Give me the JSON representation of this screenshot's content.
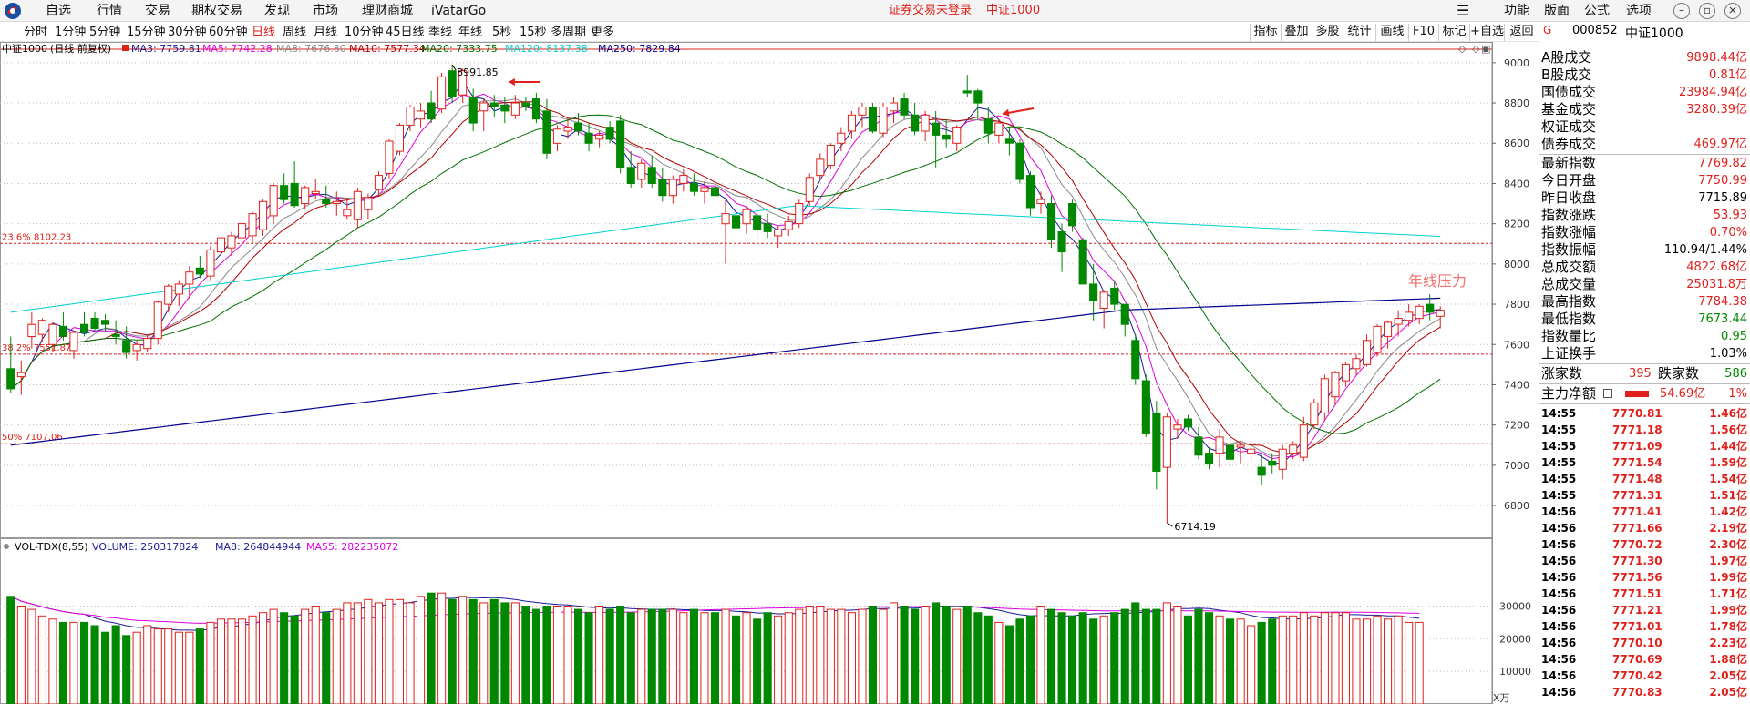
{
  "menubar": {
    "items": [
      "自选",
      "行情",
      "交易",
      "期权交易",
      "发现",
      "市场",
      "理财商城",
      "iVatarGo"
    ],
    "status_login": "证券交易未登录",
    "status_index": "中证1000",
    "right_items": [
      "功能",
      "版面",
      "公式",
      "选项"
    ],
    "window_buttons": [
      "minimize-icon",
      "restore-icon",
      "close-icon"
    ]
  },
  "periodbar": {
    "items": [
      "分时",
      "1分钟",
      "5分钟",
      "15分钟",
      "30分钟",
      "60分钟",
      "日线",
      "周线",
      "月线",
      "10分钟",
      "45日线",
      "季线",
      "年线",
      "5秒",
      "15秒",
      "多周期",
      "更多"
    ],
    "active": "日线",
    "tools": [
      "指标",
      "叠加",
      "多股",
      "统计",
      "画线",
      "F10",
      "标记",
      "+自选",
      "返回"
    ]
  },
  "indicators": {
    "title": "中证1000",
    "mode": "(日线 前复权)",
    "ma": [
      {
        "label": "MA3: 7759.81",
        "color": "#1a1a9a"
      },
      {
        "label": "MA5: 7742.28",
        "color": "#e000e0"
      },
      {
        "label": "MA8: 7676.80",
        "color": "#888888"
      },
      {
        "label": "MA10: 7577.34",
        "color": "#b00000"
      },
      {
        "label": "MA20: 7333.75",
        "color": "#007000"
      },
      {
        "label": "MA120: 8137.38",
        "color": "#00d0d0"
      },
      {
        "label": "MA250: 7829.84",
        "color": "#000090"
      }
    ]
  },
  "annotations": {
    "high_label": "8991.85",
    "low_label": "6714.19",
    "fib_236": "23.6% 8102.23",
    "fib_382": "38.2% 7551.87",
    "fib_50": "50% 7107.06",
    "resistance": "年线压力"
  },
  "volume_panel": {
    "label_name": "VOL-TDX(8,55)",
    "volume": "VOLUME: 250317824",
    "ma8": "MA8: 264844944",
    "ma55": "MA55: 282235072",
    "unit": "X万"
  },
  "chart_data": {
    "type": "candlestick",
    "price_axis": {
      "ticks": [
        6800,
        7000,
        7200,
        7400,
        7600,
        7800,
        8000,
        8200,
        8400,
        8600,
        8800,
        9000
      ],
      "range": [
        6660,
        9040
      ]
    },
    "volume_axis": {
      "ticks": [
        10000,
        20000,
        30000
      ],
      "range": [
        0,
        36000
      ]
    },
    "fib_levels": [
      8102.23,
      7551.87,
      7107.06
    ],
    "candles": [
      [
        7480,
        7640,
        7360,
        7380
      ],
      [
        7440,
        7520,
        7350,
        7460
      ],
      [
        7640,
        7760,
        7580,
        7700
      ],
      [
        7650,
        7730,
        7610,
        7720
      ],
      [
        7600,
        7710,
        7560,
        7700
      ],
      [
        7690,
        7760,
        7620,
        7640
      ],
      [
        7570,
        7670,
        7530,
        7660
      ],
      [
        7700,
        7760,
        7640,
        7660
      ],
      [
        7730,
        7760,
        7670,
        7680
      ],
      [
        7720,
        7750,
        7660,
        7700
      ],
      [
        7650,
        7720,
        7600,
        7640
      ],
      [
        7620,
        7690,
        7530,
        7560
      ],
      [
        7570,
        7620,
        7520,
        7600
      ],
      [
        7580,
        7650,
        7560,
        7630
      ],
      [
        7630,
        7820,
        7600,
        7810
      ],
      [
        7800,
        7900,
        7760,
        7890
      ],
      [
        7850,
        7920,
        7790,
        7900
      ],
      [
        7900,
        7990,
        7830,
        7960
      ],
      [
        7980,
        8040,
        7930,
        7950
      ],
      [
        7940,
        8090,
        7920,
        8070
      ],
      [
        8060,
        8140,
        8040,
        8130
      ],
      [
        8080,
        8160,
        8040,
        8140
      ],
      [
        8130,
        8220,
        8090,
        8200
      ],
      [
        8140,
        8260,
        8100,
        8250
      ],
      [
        8170,
        8320,
        8140,
        8310
      ],
      [
        8240,
        8400,
        8200,
        8390
      ],
      [
        8390,
        8450,
        8300,
        8320
      ],
      [
        8400,
        8510,
        8280,
        8290
      ],
      [
        8300,
        8390,
        8270,
        8380
      ],
      [
        8350,
        8420,
        8320,
        8360
      ],
      [
        8320,
        8390,
        8280,
        8300
      ],
      [
        8300,
        8360,
        8240,
        8310
      ],
      [
        8240,
        8330,
        8220,
        8270
      ],
      [
        8220,
        8380,
        8180,
        8360
      ],
      [
        8270,
        8350,
        8220,
        8330
      ],
      [
        8370,
        8460,
        8340,
        8440
      ],
      [
        8450,
        8620,
        8420,
        8610
      ],
      [
        8560,
        8700,
        8540,
        8690
      ],
      [
        8690,
        8790,
        8660,
        8780
      ],
      [
        8720,
        8800,
        8680,
        8760
      ],
      [
        8800,
        8860,
        8700,
        8720
      ],
      [
        8770,
        8950,
        8750,
        8930
      ],
      [
        8960,
        8990,
        8800,
        8830
      ],
      [
        8840,
        8970,
        8800,
        8960
      ],
      [
        8830,
        8870,
        8660,
        8700
      ],
      [
        8760,
        8820,
        8660,
        8800
      ],
      [
        8800,
        8840,
        8730,
        8780
      ],
      [
        8790,
        8830,
        8700,
        8760
      ],
      [
        8740,
        8840,
        8720,
        8800
      ],
      [
        8800,
        8830,
        8760,
        8780
      ],
      [
        8820,
        8850,
        8700,
        8720
      ],
      [
        8760,
        8820,
        8520,
        8550
      ],
      [
        8600,
        8690,
        8560,
        8670
      ],
      [
        8660,
        8730,
        8620,
        8680
      ],
      [
        8700,
        8750,
        8640,
        8660
      ],
      [
        8650,
        8700,
        8560,
        8600
      ],
      [
        8620,
        8660,
        8580,
        8640
      ],
      [
        8680,
        8710,
        8600,
        8620
      ],
      [
        8710,
        8740,
        8450,
        8480
      ],
      [
        8480,
        8560,
        8380,
        8400
      ],
      [
        8420,
        8520,
        8380,
        8500
      ],
      [
        8480,
        8540,
        8380,
        8400
      ],
      [
        8420,
        8480,
        8310,
        8340
      ],
      [
        8340,
        8440,
        8300,
        8420
      ],
      [
        8400,
        8470,
        8360,
        8440
      ],
      [
        8400,
        8450,
        8340,
        8360
      ],
      [
        8360,
        8410,
        8300,
        8380
      ],
      [
        8380,
        8420,
        8320,
        8340
      ],
      [
        8200,
        8330,
        8000,
        8250
      ],
      [
        8240,
        8310,
        8170,
        8180
      ],
      [
        8200,
        8290,
        8150,
        8270
      ],
      [
        8240,
        8300,
        8130,
        8170
      ],
      [
        8200,
        8250,
        8130,
        8160
      ],
      [
        8140,
        8190,
        8080,
        8170
      ],
      [
        8170,
        8240,
        8140,
        8210
      ],
      [
        8200,
        8320,
        8180,
        8300
      ],
      [
        8310,
        8450,
        8290,
        8430
      ],
      [
        8440,
        8550,
        8420,
        8520
      ],
      [
        8490,
        8600,
        8470,
        8590
      ],
      [
        8600,
        8680,
        8560,
        8650
      ],
      [
        8660,
        8760,
        8620,
        8740
      ],
      [
        8740,
        8800,
        8680,
        8780
      ],
      [
        8780,
        8800,
        8650,
        8660
      ],
      [
        8650,
        8800,
        8630,
        8780
      ],
      [
        8760,
        8830,
        8700,
        8800
      ],
      [
        8820,
        8850,
        8720,
        8740
      ],
      [
        8740,
        8800,
        8640,
        8660
      ],
      [
        8660,
        8760,
        8610,
        8740
      ],
      [
        8700,
        8760,
        8480,
        8640
      ],
      [
        8640,
        8720,
        8580,
        8620
      ],
      [
        8600,
        8690,
        8560,
        8680
      ],
      [
        8860,
        8940,
        8830,
        8850
      ],
      [
        8860,
        8870,
        8720,
        8800
      ],
      [
        8720,
        8780,
        8600,
        8650
      ],
      [
        8640,
        8720,
        8600,
        8700
      ],
      [
        8620,
        8680,
        8540,
        8600
      ],
      [
        8600,
        8620,
        8400,
        8420
      ],
      [
        8440,
        8460,
        8240,
        8280
      ],
      [
        8300,
        8360,
        8250,
        8320
      ],
      [
        8300,
        8340,
        8080,
        8120
      ],
      [
        8160,
        8200,
        7960,
        8060
      ],
      [
        8300,
        8320,
        8160,
        8190
      ],
      [
        8120,
        8130,
        7900,
        7900
      ],
      [
        7900,
        8000,
        7720,
        7820
      ],
      [
        7780,
        7870,
        7680,
        7860
      ],
      [
        7880,
        7920,
        7770,
        7800
      ],
      [
        7800,
        7800,
        7640,
        7700
      ],
      [
        7620,
        7650,
        7400,
        7430
      ],
      [
        7420,
        7450,
        7140,
        7160
      ],
      [
        7260,
        7320,
        6880,
        6970
      ],
      [
        6990,
        7260,
        6714,
        7240
      ],
      [
        7180,
        7230,
        7130,
        7200
      ],
      [
        7230,
        7250,
        7170,
        7190
      ],
      [
        7140,
        7190,
        7030,
        7050
      ],
      [
        7060,
        7090,
        6980,
        7010
      ],
      [
        7060,
        7180,
        6990,
        7140
      ],
      [
        7100,
        7140,
        6990,
        7030
      ],
      [
        7090,
        7120,
        7010,
        7100
      ],
      [
        7060,
        7120,
        7020,
        7080
      ],
      [
        6990,
        7060,
        6900,
        6950
      ],
      [
        7020,
        7060,
        6960,
        7000
      ],
      [
        6980,
        7100,
        6930,
        7080
      ],
      [
        7060,
        7120,
        7030,
        7100
      ],
      [
        7040,
        7240,
        7020,
        7200
      ],
      [
        7200,
        7330,
        7180,
        7310
      ],
      [
        7260,
        7450,
        7220,
        7430
      ],
      [
        7340,
        7470,
        7300,
        7460
      ],
      [
        7420,
        7510,
        7390,
        7500
      ],
      [
        7480,
        7550,
        7450,
        7530
      ],
      [
        7500,
        7650,
        7490,
        7620
      ],
      [
        7560,
        7700,
        7540,
        7690
      ],
      [
        7640,
        7720,
        7580,
        7710
      ],
      [
        7700,
        7770,
        7640,
        7730
      ],
      [
        7720,
        7800,
        7690,
        7760
      ],
      [
        7730,
        7800,
        7700,
        7790
      ],
      [
        7800,
        7850,
        7720,
        7760
      ],
      [
        7740,
        7790,
        7680,
        7770
      ]
    ],
    "volumes": [
      33000,
      30000,
      29000,
      27000,
      26000,
      25000,
      25000,
      25000,
      24000,
      22000,
      24000,
      21000,
      22000,
      24000,
      23000,
      23000,
      22000,
      22000,
      23000,
      25000,
      26000,
      26000,
      26000,
      27000,
      28000,
      29000,
      28000,
      27000,
      29000,
      30000,
      28000,
      29000,
      31000,
      31000,
      32000,
      31000,
      32000,
      32000,
      31000,
      33000,
      34000,
      34000,
      32000,
      33000,
      32000,
      31000,
      32000,
      31000,
      31000,
      30000,
      29000,
      30000,
      30000,
      30000,
      29000,
      28000,
      30000,
      29000,
      30000,
      28000,
      29000,
      29000,
      29000,
      29000,
      28000,
      29000,
      28000,
      28000,
      29000,
      27000,
      28000,
      26000,
      28000,
      27000,
      28000,
      29000,
      30000,
      30000,
      29000,
      29000,
      28000,
      29000,
      30000,
      29000,
      31000,
      30000,
      29000,
      30000,
      31000,
      30000,
      29000,
      30000,
      28000,
      27000,
      25000,
      24000,
      26000,
      27000,
      30000,
      29000,
      28000,
      27000,
      28000,
      26000,
      27000,
      28000,
      29000,
      31000,
      29000,
      29000,
      31000,
      30000,
      27000,
      29000,
      28000,
      27000,
      26000,
      26000,
      24000,
      25000,
      26000,
      27000,
      27000,
      28000,
      27000,
      28000,
      28000,
      28000,
      26000,
      26000,
      27000,
      26000,
      27000,
      25000,
      25000
    ]
  },
  "side": {
    "code": "000852",
    "name": "中证1000",
    "tag": "G",
    "rows1": [
      {
        "label": "A股成交",
        "value": "9898.44亿",
        "color": "#e0201b"
      },
      {
        "label": "B股成交",
        "value": "0.81亿",
        "color": "#e0201b"
      },
      {
        "label": "国债成交",
        "value": "23984.94亿",
        "color": "#e0201b"
      },
      {
        "label": "基金成交",
        "value": "3280.39亿",
        "color": "#e0201b"
      },
      {
        "label": "权证成交",
        "value": "",
        "color": "#e0201b"
      },
      {
        "label": "债券成交",
        "value": "469.97亿",
        "color": "#e0201b"
      }
    ],
    "rows2": [
      {
        "label": "最新指数",
        "value": "7769.82",
        "color": "#e0201b"
      },
      {
        "label": "今日开盘",
        "value": "7750.99",
        "color": "#e0201b"
      },
      {
        "label": "昨日收盘",
        "value": "7715.89",
        "color": "#000000"
      },
      {
        "label": "指数涨跌",
        "value": "53.93",
        "color": "#e0201b"
      },
      {
        "label": "指数涨幅",
        "value": "0.70%",
        "color": "#e0201b"
      },
      {
        "label": "指数振幅",
        "value": "110.94/1.44%",
        "color": "#000000"
      },
      {
        "label": "总成交额",
        "value": "4822.68亿",
        "color": "#e0201b"
      },
      {
        "label": "总成交量",
        "value": "25031.8万",
        "color": "#e0201b"
      },
      {
        "label": "最高指数",
        "value": "7784.38",
        "color": "#e0201b"
      },
      {
        "label": "最低指数",
        "value": "7673.44",
        "color": "#008800"
      },
      {
        "label": "指数量比",
        "value": "0.95",
        "color": "#008800"
      },
      {
        "label": "上证换手",
        "value": "1.03%",
        "color": "#000000"
      }
    ],
    "updown": {
      "up_label": "涨家数",
      "up": "395",
      "down_label": "跌家数",
      "down": "586"
    },
    "mainflow": {
      "label": "主力净额",
      "value": "54.69亿",
      "pct": "1%"
    },
    "ticks": [
      {
        "time": "14:55",
        "price": "7770.81",
        "vol": "1.46亿"
      },
      {
        "time": "14:55",
        "price": "7771.18",
        "vol": "1.56亿"
      },
      {
        "time": "14:55",
        "price": "7771.09",
        "vol": "1.44亿"
      },
      {
        "time": "14:55",
        "price": "7771.54",
        "vol": "1.59亿"
      },
      {
        "time": "14:55",
        "price": "7771.48",
        "vol": "1.54亿"
      },
      {
        "time": "14:55",
        "price": "7771.31",
        "vol": "1.51亿"
      },
      {
        "time": "14:56",
        "price": "7771.41",
        "vol": "1.42亿"
      },
      {
        "time": "14:56",
        "price": "7771.66",
        "vol": "2.19亿"
      },
      {
        "time": "14:56",
        "price": "7770.72",
        "vol": "2.30亿"
      },
      {
        "time": "14:56",
        "price": "7771.30",
        "vol": "1.97亿"
      },
      {
        "time": "14:56",
        "price": "7771.56",
        "vol": "1.99亿"
      },
      {
        "time": "14:56",
        "price": "7771.51",
        "vol": "1.71亿"
      },
      {
        "time": "14:56",
        "price": "7771.21",
        "vol": "1.99亿"
      },
      {
        "time": "14:56",
        "price": "7771.01",
        "vol": "1.78亿"
      },
      {
        "time": "14:56",
        "price": "7770.10",
        "vol": "2.23亿"
      },
      {
        "time": "14:56",
        "price": "7770.69",
        "vol": "1.88亿"
      },
      {
        "time": "14:56",
        "price": "7770.42",
        "vol": "2.05亿"
      },
      {
        "time": "14:56",
        "price": "7770.83",
        "vol": "2.05亿"
      }
    ]
  }
}
